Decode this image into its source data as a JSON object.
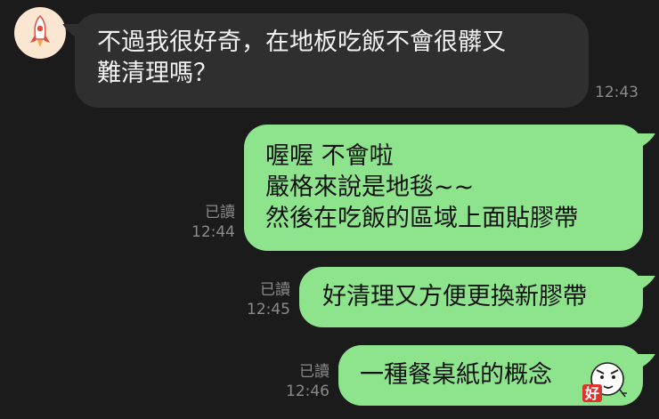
{
  "chat": {
    "incoming": [
      {
        "text": "不過我很好奇，在地板吃飯不會很髒又\n難清理嗎？",
        "time": "12:43"
      }
    ],
    "outgoing": [
      {
        "text": "喔喔  不會啦\n嚴格來說是地毯~~\n然後在吃飯的區域上面貼膠帶",
        "status": "已讀",
        "time": "12:44"
      },
      {
        "text": "好清理又方便更換新膠帶",
        "status": "已讀",
        "time": "12:45"
      },
      {
        "text": "一種餐桌紙的概念",
        "status": "已讀",
        "time": "12:46",
        "sticker": "好"
      }
    ]
  },
  "avatar": {
    "icon": "rocket-icon",
    "bg_color": "#fbe6d2"
  },
  "colors": {
    "background": "#1b1b1b",
    "incoming_bubble": "#2f2f2f",
    "outgoing_bubble": "#8de48c",
    "time_text": "#8a8a8a"
  }
}
